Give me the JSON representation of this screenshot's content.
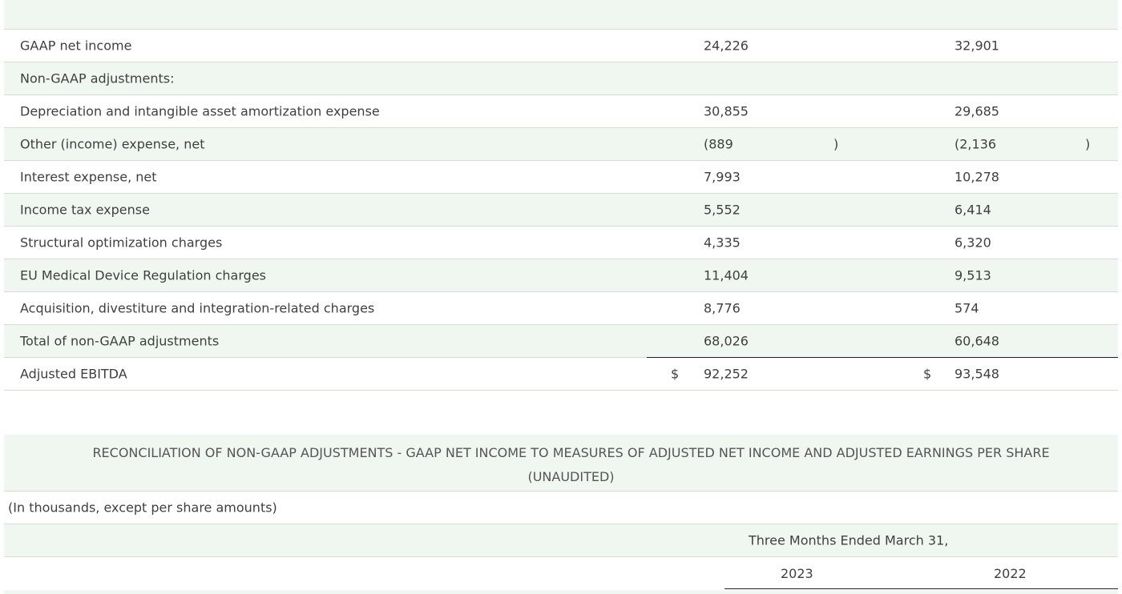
{
  "table1": {
    "rows": [
      {
        "label": "",
        "v2023": "",
        "v2022": ""
      },
      {
        "label": "GAAP net income",
        "v2023": "24,226",
        "v2022": "32,901"
      },
      {
        "label": "Non-GAAP adjustments:",
        "v2023": "",
        "v2022": ""
      },
      {
        "label": "Depreciation and intangible asset amortization expense",
        "v2023": "30,855",
        "v2022": "29,685"
      },
      {
        "label": "Other (income) expense, net",
        "v2023": "(889",
        "v2022": "(2,136",
        "paren1": ")",
        "paren2": ")"
      },
      {
        "label": "Interest expense, net",
        "v2023": "7,993",
        "v2022": "10,278"
      },
      {
        "label": "Income tax expense",
        "v2023": "5,552",
        "v2022": "6,414"
      },
      {
        "label": "Structural optimization charges",
        "v2023": "4,335",
        "v2022": "6,320"
      },
      {
        "label": "EU Medical Device Regulation charges",
        "v2023": "11,404",
        "v2022": "9,513"
      },
      {
        "label": "Acquisition, divestiture and integration-related charges",
        "v2023": "8,776",
        "v2022": "574"
      },
      {
        "label": "Total of non-GAAP adjustments",
        "v2023": "68,026",
        "v2022": "60,648"
      },
      {
        "label": "Adjusted EBITDA",
        "v2023": "92,252",
        "v2022": "93,548",
        "dollar1": "$",
        "dollar2": "$"
      }
    ]
  },
  "table2": {
    "title": "RECONCILIATION OF NON-GAAP ADJUSTMENTS - GAAP NET INCOME TO MEASURES OF ADJUSTED NET INCOME AND ADJUSTED EARNINGS PER SHARE (UNAUDITED)",
    "note": "(In thousands, except per share amounts)",
    "period": "Three Months Ended March 31,",
    "year1": "2023",
    "year2": "2022"
  }
}
